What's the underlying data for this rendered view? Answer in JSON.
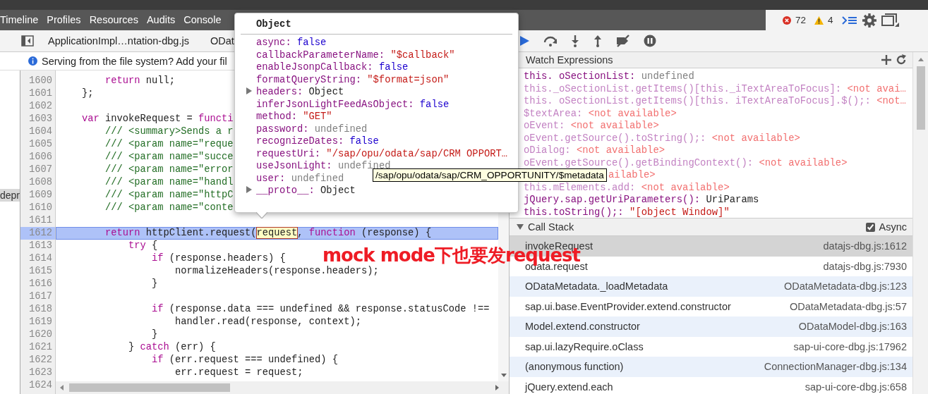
{
  "main_toolbar": {
    "tabs": [
      {
        "label": "Timeline",
        "selected": false
      },
      {
        "label": "Profiles",
        "selected": false
      },
      {
        "label": "Resources",
        "selected": false
      },
      {
        "label": "Audits",
        "selected": false
      },
      {
        "label": "Console",
        "selected": false
      }
    ],
    "error_count": "72",
    "warning_count": "4"
  },
  "file_tabs": [
    {
      "label": "ApplicationImpl…ntation-dbg.js"
    },
    {
      "label": "ODat"
    }
  ],
  "info_bar": {
    "message": "Serving from the file system? Add your fil"
  },
  "navigator": {
    "label": "depr"
  },
  "editor": {
    "lines": [
      {
        "number": "1600",
        "current": false,
        "code": [
          {
            "text": "        return",
            "kind": "keyword"
          },
          {
            "text": " null;",
            "kind": "plain"
          }
        ]
      },
      {
        "number": "1601",
        "current": false,
        "code": [
          {
            "text": "    };",
            "kind": "plain"
          }
        ]
      },
      {
        "number": "1602",
        "current": false
      },
      {
        "number": "1603",
        "current": false,
        "code": [
          {
            "text": "    var",
            "kind": "keyword"
          },
          {
            "text": " invokeRequest = ",
            "kind": "plain"
          },
          {
            "text": "functi",
            "kind": "keyword"
          }
        ]
      },
      {
        "number": "1604",
        "current": false,
        "code": [
          {
            "text": "        /// <summary>Sends a r",
            "kind": "comment"
          }
        ]
      },
      {
        "number": "1605",
        "current": false,
        "code": [
          {
            "text": "        /// <param name=\"reque",
            "kind": "comment"
          }
        ]
      },
      {
        "number": "1606",
        "current": false,
        "code": [
          {
            "text": "        /// <param name=\"succe",
            "kind": "comment"
          }
        ]
      },
      {
        "number": "1607",
        "current": false,
        "code": [
          {
            "text": "        /// <param name=\"error",
            "kind": "comment"
          }
        ]
      },
      {
        "number": "1608",
        "current": false,
        "code": [
          {
            "text": "        /// <param name=\"handl",
            "kind": "comment"
          }
        ]
      },
      {
        "number": "1609",
        "current": false,
        "code": [
          {
            "text": "        /// <param name=\"httpC",
            "kind": "comment"
          }
        ]
      },
      {
        "number": "1610",
        "current": false,
        "code": [
          {
            "text": "        /// <param name=\"conte",
            "kind": "comment"
          }
        ]
      },
      {
        "number": "1611",
        "current": false
      },
      {
        "number": "1612",
        "current": true,
        "code": [
          {
            "text": "        return",
            "kind": "keyword"
          },
          {
            "text": " httpClient.request(",
            "kind": "plain"
          },
          {
            "text": "request",
            "kind": "highlight"
          },
          {
            "text": ", ",
            "kind": "plain"
          },
          {
            "text": "function",
            "kind": "keyword"
          },
          {
            "text": " (response) {",
            "kind": "plain"
          }
        ]
      },
      {
        "number": "1613",
        "current": false,
        "code": [
          {
            "text": "            try",
            "kind": "keyword"
          },
          {
            "text": " {",
            "kind": "plain"
          }
        ]
      },
      {
        "number": "1614",
        "current": false,
        "code": [
          {
            "text": "                if",
            "kind": "keyword"
          },
          {
            "text": " (response.headers) {",
            "kind": "plain"
          }
        ]
      },
      {
        "number": "1615",
        "current": false,
        "code": [
          {
            "text": "                    normalizeHeaders(response.headers);",
            "kind": "plain"
          }
        ]
      },
      {
        "number": "1616",
        "current": false,
        "code": [
          {
            "text": "                }",
            "kind": "plain"
          }
        ]
      },
      {
        "number": "1617",
        "current": false
      },
      {
        "number": "1618",
        "current": false,
        "code": [
          {
            "text": "                if",
            "kind": "keyword"
          },
          {
            "text": " (response.data === undefined && response.statusCode !==",
            "kind": "plain"
          }
        ]
      },
      {
        "number": "1619",
        "current": false,
        "code": [
          {
            "text": "                    handler.read(response, context);",
            "kind": "plain"
          }
        ]
      },
      {
        "number": "1620",
        "current": false,
        "code": [
          {
            "text": "                }",
            "kind": "plain"
          }
        ]
      },
      {
        "number": "1621",
        "current": false,
        "code": [
          {
            "text": "            } ",
            "kind": "plain"
          },
          {
            "text": "catch",
            "kind": "keyword"
          },
          {
            "text": " (err) {",
            "kind": "plain"
          }
        ]
      },
      {
        "number": "1622",
        "current": false,
        "code": [
          {
            "text": "                if",
            "kind": "keyword"
          },
          {
            "text": " (err.request === undefined) {",
            "kind": "plain"
          }
        ]
      },
      {
        "number": "1623",
        "current": false,
        "code": [
          {
            "text": "                    err.request = request;",
            "kind": "plain"
          }
        ]
      },
      {
        "number": "1624",
        "current": false
      }
    ]
  },
  "watch_expressions": {
    "title": "Watch Expressions",
    "items": [
      {
        "name": "this. oSectionList:",
        "value": "undefined",
        "kind": "undefined"
      },
      {
        "name": "this._oSectionList.getItems()[this._iTextAreaToFocus]:",
        "value": "<not avai…",
        "kind": "unavailable"
      },
      {
        "name": "this. oSectionList.getItems()[this. iTextAreaToFocus].$();:",
        "value": "<not…",
        "kind": "unavailable"
      },
      {
        "name": "$textArea:",
        "value": "<not available>",
        "kind": "unavailable"
      },
      {
        "name": "oEvent:",
        "value": "<not available>",
        "kind": "unavailable"
      },
      {
        "name": "oEvent.getSource().toString();:",
        "value": "<not available>",
        "kind": "unavailable"
      },
      {
        "name": "oDialog:",
        "value": "<not available>",
        "kind": "unavailable"
      },
      {
        "name": "oEvent.getSource().getBindingContext():",
        "value": "<not available>",
        "kind": "unavailable"
      },
      {
        "value": "ailable>",
        "kind": "unavailable"
      },
      {
        "name": "this.mElements.add:",
        "value": "<not available>",
        "kind": "unavailable"
      },
      {
        "name": "jQuery.sap.getUriParameters():",
        "value": "UriParams",
        "kind": "object"
      },
      {
        "name": "this.toString();:",
        "value": "\"[object Window]\"",
        "kind": "string"
      }
    ]
  },
  "call_stack": {
    "title": "Call Stack",
    "async_label": "Async",
    "async_checked": true,
    "frames": [
      {
        "function": "invokeRequest",
        "location": "datajs-dbg.js:1612",
        "selected": true
      },
      {
        "function": "odata.request",
        "location": "datajs-dbg.js:7930",
        "selected": false
      },
      {
        "function": "ODataMetadata._loadMetadata",
        "location": "ODataMetadata-dbg.js:123",
        "selected": false
      },
      {
        "function": "sap.ui.base.EventProvider.extend.constructor",
        "location": "ODataMetadata-dbg.js:57",
        "selected": false
      },
      {
        "function": "Model.extend.constructor",
        "location": "ODataModel-dbg.js:163",
        "selected": false
      },
      {
        "function": "sap.ui.lazyRequire.oClass",
        "location": "sap-ui-core-dbg.js:17962",
        "selected": false
      },
      {
        "function": "(anonymous function)",
        "location": "ConnectionManager-dbg.js:134",
        "selected": false
      },
      {
        "function": "jQuery.extend.each",
        "location": "sap-ui-core-dbg.js:658",
        "selected": false
      }
    ]
  },
  "object_popover": {
    "title": "Object",
    "properties": [
      {
        "key": "async:",
        "value": "false",
        "kind": "boolean",
        "expandable": false
      },
      {
        "key": "callbackParameterName:",
        "value": "\"$callback\"",
        "kind": "string",
        "expandable": false
      },
      {
        "key": "enableJsonpCallback:",
        "value": "false",
        "kind": "boolean",
        "expandable": false
      },
      {
        "key": "formatQueryString:",
        "value": "\"$format=json\"",
        "kind": "string",
        "expandable": false
      },
      {
        "key": "headers:",
        "value": "Object",
        "kind": "object",
        "expandable": true
      },
      {
        "key": "inferJsonLightFeedAsObject:",
        "value": "false",
        "kind": "boolean",
        "expandable": false
      },
      {
        "key": "method:",
        "value": "\"GET\"",
        "kind": "string",
        "expandable": false
      },
      {
        "key": "password:",
        "value": "undefined",
        "kind": "undefined",
        "expandable": false
      },
      {
        "key": "recognizeDates:",
        "value": "false",
        "kind": "boolean",
        "expandable": false
      },
      {
        "key": "requestUri:",
        "value": "\"/sap/opu/odata/sap/CRM OPPORT…",
        "kind": "string",
        "expandable": false
      },
      {
        "key": "useJsonLight:",
        "value": "undefined",
        "kind": "undefined",
        "expandable": false
      },
      {
        "key": "user:",
        "value": "undefined",
        "kind": "undefined",
        "expandable": false
      },
      {
        "key": "__proto__:",
        "value": "Object",
        "kind": "object",
        "expandable": true
      }
    ]
  },
  "tooltip": {
    "text": "/sap/opu/odata/sap/CRM_OPPORTUNITY/$metadata"
  },
  "annotation": {
    "text": "mock mode下也要发request"
  }
}
